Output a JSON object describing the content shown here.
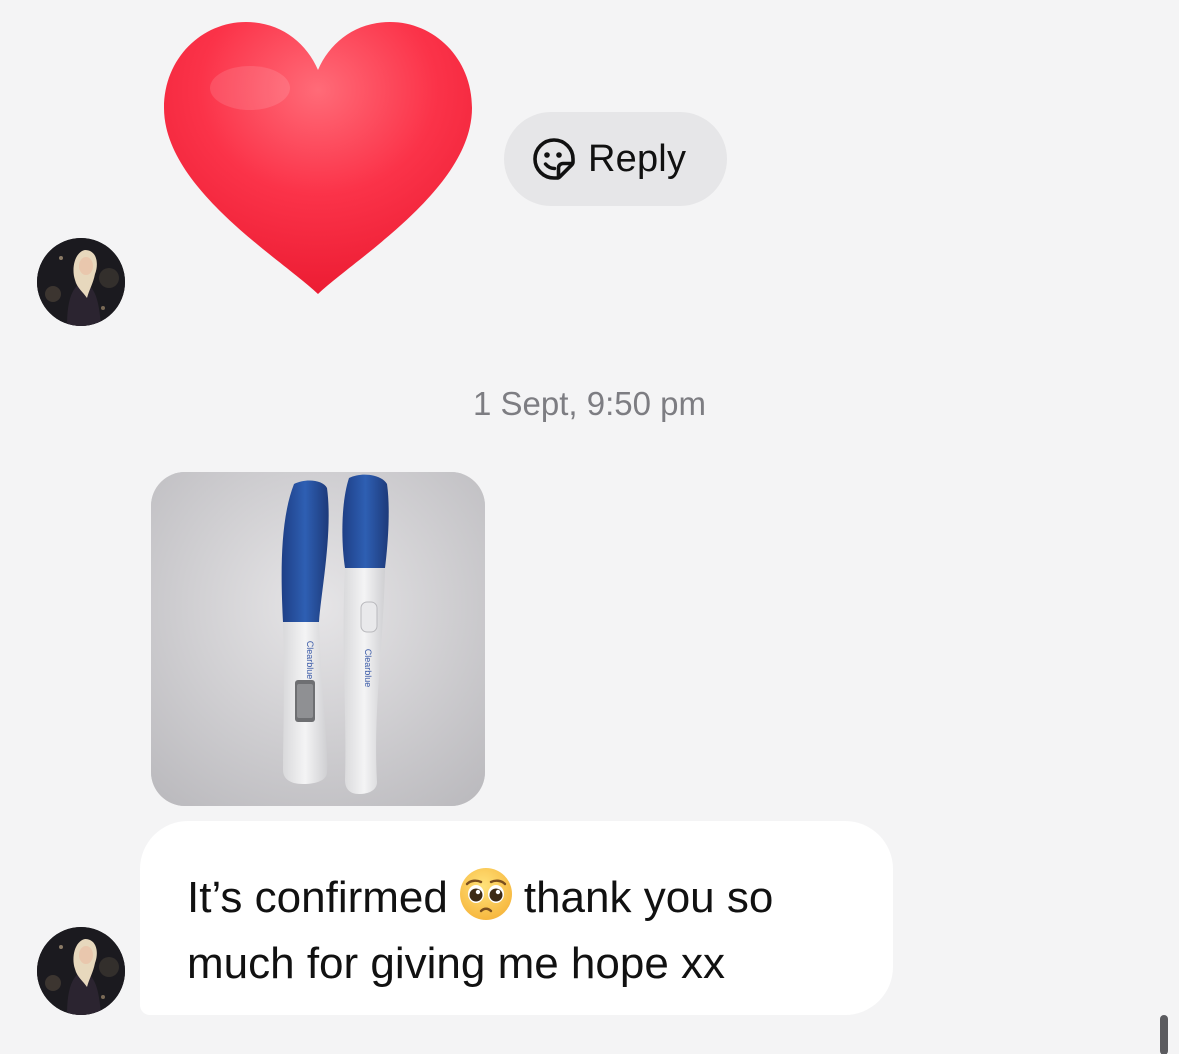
{
  "reply_button": {
    "label": "Reply",
    "icon": "sticker-reply-icon"
  },
  "reaction": {
    "icon": "red-heart-icon",
    "color": "#f2263a"
  },
  "timestamp": "1 Sept, 9:50 pm",
  "attachment": {
    "icon": "photo-two-pregnancy-tests"
  },
  "message": {
    "line1_before_emoji": "It’s confirmed",
    "emoji": "pleading-face-emoji",
    "line1_after_emoji": "thank you so",
    "line2": "much for giving me hope xx"
  },
  "colors": {
    "background": "#f4f4f5",
    "bubble": "#ffffff",
    "reply_pill": "#e6e6e8",
    "timestamp_text": "#7d7d82"
  }
}
